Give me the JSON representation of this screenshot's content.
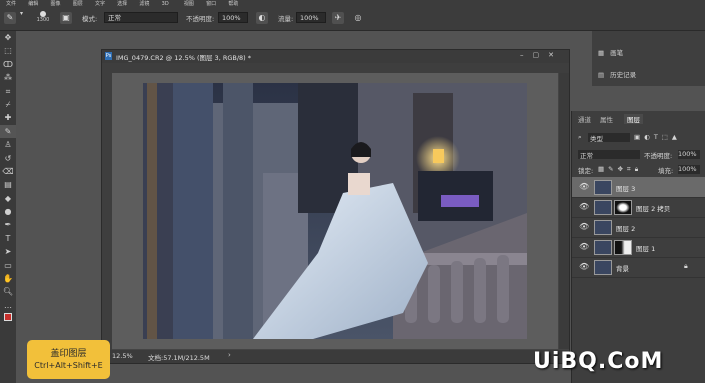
{
  "menu": [
    "文件",
    "编辑",
    "图像",
    "图层",
    "文字",
    "选择",
    "滤镜",
    "3D",
    "视图",
    "窗口",
    "帮助"
  ],
  "options": {
    "brush_size": "1300",
    "mode_label": "模式:",
    "mode_value": "正常",
    "opacity_label": "不透明度:",
    "opacity_value": "100%",
    "flow_label": "流量:",
    "flow_value": "100%"
  },
  "document": {
    "title": "IMG_0479.CR2 @ 12.5% (图层 3, RGB/8) *",
    "zoom": "12.5%",
    "doc_size": "文档:57.1M/212.5M"
  },
  "panel_top": {
    "item1": "画笔",
    "item2": "历史记录"
  },
  "layers_panel": {
    "tabs": [
      "通道",
      "属性",
      "图层"
    ],
    "active_tab": "图层",
    "kind_label": "类型",
    "blend_mode": "正常",
    "opacity_label": "不透明度:",
    "opacity_value": "100%",
    "lock_label": "锁定:",
    "fill_label": "填充:",
    "fill_value": "100%",
    "layers": [
      {
        "name": "图层 3",
        "selected": true,
        "mask": false
      },
      {
        "name": "图层 2 拷贝",
        "selected": false,
        "mask": true
      },
      {
        "name": "图层 2",
        "selected": false,
        "mask": false
      },
      {
        "name": "图层 1",
        "selected": false,
        "mask": true
      },
      {
        "name": "背景",
        "selected": false,
        "mask": false
      }
    ]
  },
  "tooltip": {
    "title": "盖印图层",
    "shortcut": "Ctrl+Alt+Shift+E"
  },
  "watermark": "UiBQ.CoM"
}
